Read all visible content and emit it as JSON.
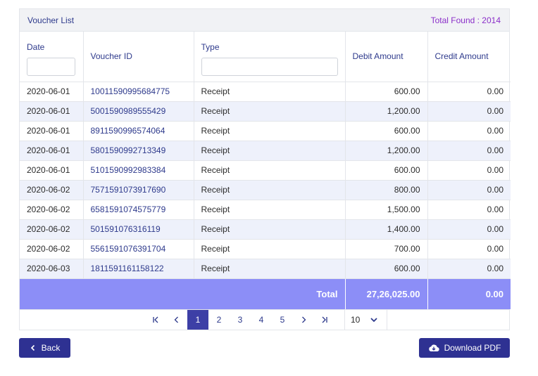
{
  "card": {
    "title": "Voucher List",
    "total_found": "Total Found : 2014"
  },
  "columns": {
    "date": "Date",
    "voucher_id": "Voucher ID",
    "type": "Type",
    "debit": "Debit Amount",
    "credit": "Credit Amount"
  },
  "filters": {
    "date_value": "",
    "type_value": ""
  },
  "rows": [
    {
      "date": "2020-06-01",
      "voucher_id": "10011590995684775",
      "type": "Receipt",
      "debit": "600.00",
      "credit": "0.00"
    },
    {
      "date": "2020-06-01",
      "voucher_id": "5001590989555429",
      "type": "Receipt",
      "debit": "1,200.00",
      "credit": "0.00"
    },
    {
      "date": "2020-06-01",
      "voucher_id": "8911590996574064",
      "type": "Receipt",
      "debit": "600.00",
      "credit": "0.00"
    },
    {
      "date": "2020-06-01",
      "voucher_id": "5801590992713349",
      "type": "Receipt",
      "debit": "1,200.00",
      "credit": "0.00"
    },
    {
      "date": "2020-06-01",
      "voucher_id": "5101590992983384",
      "type": "Receipt",
      "debit": "600.00",
      "credit": "0.00"
    },
    {
      "date": "2020-06-02",
      "voucher_id": "7571591073917690",
      "type": "Receipt",
      "debit": "800.00",
      "credit": "0.00"
    },
    {
      "date": "2020-06-02",
      "voucher_id": "6581591074575779",
      "type": "Receipt",
      "debit": "1,500.00",
      "credit": "0.00"
    },
    {
      "date": "2020-06-02",
      "voucher_id": "501591076316119",
      "type": "Receipt",
      "debit": "1,400.00",
      "credit": "0.00"
    },
    {
      "date": "2020-06-02",
      "voucher_id": "5561591076391704",
      "type": "Receipt",
      "debit": "700.00",
      "credit": "0.00"
    },
    {
      "date": "2020-06-03",
      "voucher_id": "1811591161158122",
      "type": "Receipt",
      "debit": "600.00",
      "credit": "0.00"
    }
  ],
  "totals": {
    "label": "Total",
    "debit": "27,26,025.00",
    "credit": "0.00"
  },
  "pagination": {
    "icons": {
      "first": "first-page-icon",
      "prev": "previous-page-icon",
      "next": "next-page-icon",
      "last": "last-page-icon"
    },
    "pages": [
      "1",
      "2",
      "3",
      "4",
      "5"
    ],
    "current": "1",
    "per_page": "10"
  },
  "buttons": {
    "back": "Back",
    "download": "Download PDF"
  },
  "colors": {
    "primary": "#2e3192",
    "accent_row": "#8c8ef7",
    "stripe": "#eef1fb",
    "total_found": "#8b2fc9"
  }
}
